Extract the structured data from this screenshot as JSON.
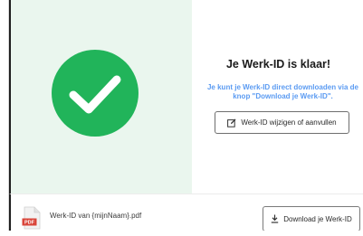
{
  "success": {
    "title": "Je Werk-ID is klaar!",
    "subtitle": "Je kunt je Werk-ID direct downloaden via de knop \"Download je Werk-ID\".",
    "check_icon": "check-circle-icon"
  },
  "actions": {
    "edit_label": "Werk-ID wijzigen of aanvullen",
    "edit_icon": "edit-icon",
    "download_label": "Download je Werk-ID",
    "download_icon": "download-icon"
  },
  "file": {
    "icon_text": "PDF",
    "name": "Werk-ID van {mijnNaam}.pdf"
  },
  "colors": {
    "success_green": "#21b45a",
    "panel_green": "#eaf6ee",
    "link_blue": "#5b9bf2",
    "pdf_red": "#d9453a"
  }
}
